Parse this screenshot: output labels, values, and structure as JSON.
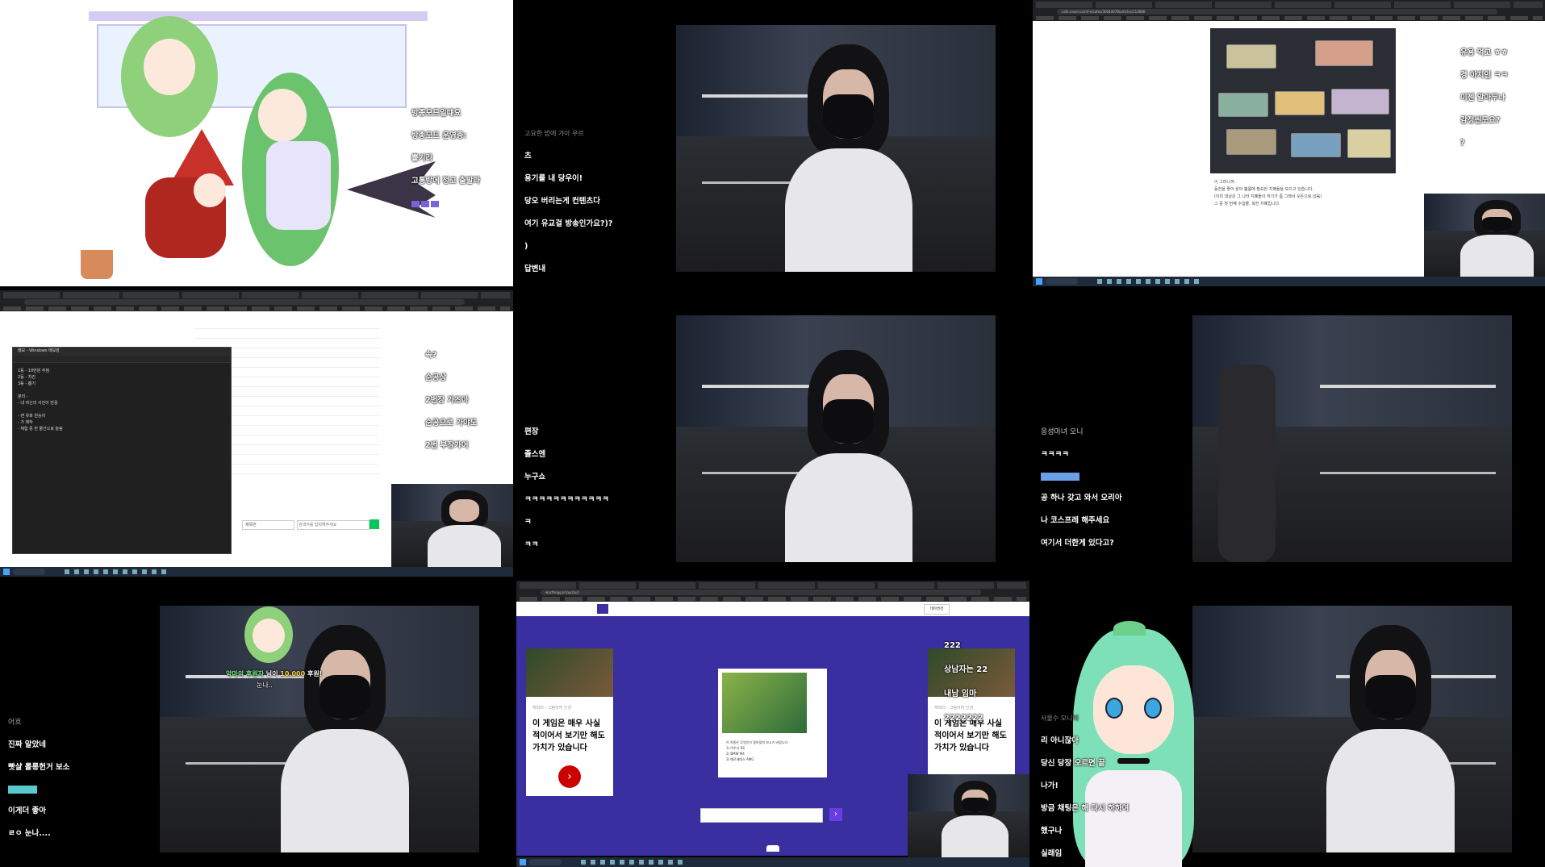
{
  "tile1": {
    "chat": [
      "방종모드일떄요",
      "방종모드 운영중:",
      "뽈기라",
      "고통방에 정고 출발다"
    ]
  },
  "tile2": {
    "chat_user": "고요한 밤에 갸아 우르",
    "chat": [
      "츠",
      "용기를 내 당우이!",
      "당오 버리는게 컨텐츠다",
      "여기 유교걸 방송인가요?)?",
      ")",
      "답변내"
    ]
  },
  "tile3": {
    "url": "cafe.naver.com/f-e/cafes/30044078/articles/114686",
    "chat": [
      "유용 먹고 ㅎㅎ",
      "경 아지인 ㅋㅋ",
      "이젠 알아두나",
      "감정씬도요?",
      "?"
    ],
    "doc_lines": [
      "이 그러니까..",
      "동전을 좋아 삼아 뽑룸에 필요한 지폐들을 모으고 있습니다.",
      "(이미 대상은 그 나라 지폐들이 하기가 좀 그래서 웃돈으로 샀음)",
      "그 중 첫 번째 수집물, 북한 지폐입니다."
    ]
  },
  "tile4": {
    "notepad_title": "메모 - Windows 메모장",
    "notepad_lines": [
      "1등 - 10만원 추첨",
      "2등 - 치킨",
      "3등 - 뽑기",
      "",
      "분리 -",
      "- 내 자신의 사진이 반응",
      "",
      "- 캔 유파 원숭이",
      "- 가 제작",
      "- 체험 중 한 물건으로 놀림"
    ],
    "chat": [
      "속?",
      "순공상",
      "2번장 가즈아",
      "순공으로 가야도",
      "2번 부장가어"
    ],
    "search_placeholder": "검색어를 입력해주세요",
    "search_select": "제목만"
  },
  "tile5": {
    "chat": [
      "편장",
      "졸스엔",
      "누구쇼",
      "ㅋㅋㅋㅋㅋㅋㅋㅋㅋㅋㅋㅋ",
      "ㅋ",
      "ㅋㅋ"
    ]
  },
  "tile6": {
    "chat_user": "응성마녀 오니",
    "chat": [
      "ㅋㅋㅋㅋ",
      "공 하나 갖고 와서 오리아",
      "나 코스프레 해주세요",
      "여기서 더한게 있다고?"
    ]
  },
  "tile7": {
    "chat_user": "어흐",
    "chat": [
      "진짜 알았네",
      "빳샬 롤롱헌거 보소",
      "이게더 좋아",
      "ㄹㅇ 눈나...."
    ],
    "donation": {
      "name": "악마의 후원자",
      "text": "님이",
      "amount": "10,000",
      "suffix": "후원!",
      "message": "눈나.."
    }
  },
  "tile8": {
    "url": "wacthngg.kr/quiz/u/c",
    "card_label": "캐릭터 - 그림이야 인생",
    "card_text": "이 게임은 매우 사실\n적이어서 보기만 해도\n가치가 있습니다",
    "popup_lines": [
      "이 차종은 무엇인가 알아맞혀 보시기 바랍니다",
      "1) 아우디 RS",
      "2) BMW M4",
      "3) 메르세데스 AMG"
    ],
    "button_label": "테마변경",
    "chat": [
      "222",
      "상남자는 22",
      "내남 임마",
      "2222222"
    ]
  },
  "tile9": {
    "chat_user": "사물수 모니터",
    "chat": [
      "리 아니잖아",
      "당신 당장 오르면 끝",
      "나가!",
      "방금 채팅은 해 다시 하하여",
      "했구나",
      "실래임"
    ]
  }
}
